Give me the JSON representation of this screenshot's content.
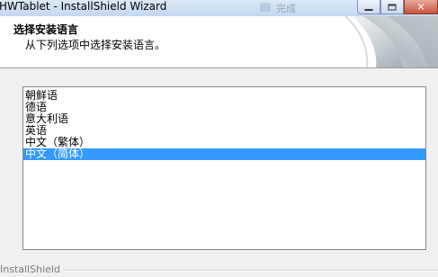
{
  "window": {
    "title": "HWTablet - InstallShield Wizard",
    "taskbar_ghost_text": "完成",
    "close_glyph": "✕"
  },
  "header": {
    "title": "选择安装语言",
    "subtitle": "从下列选项中选择安装语言。"
  },
  "language_list": {
    "items": [
      "朝鲜语",
      "德语",
      "意大利语",
      "英语",
      "中文（繁体）",
      "中文（简体）"
    ],
    "selected_index": 5
  },
  "footer": {
    "label": "InstallShield"
  },
  "colors": {
    "selection": "#3399ff",
    "header_background": "#ffffff",
    "window_background": "#f0f0f0"
  }
}
